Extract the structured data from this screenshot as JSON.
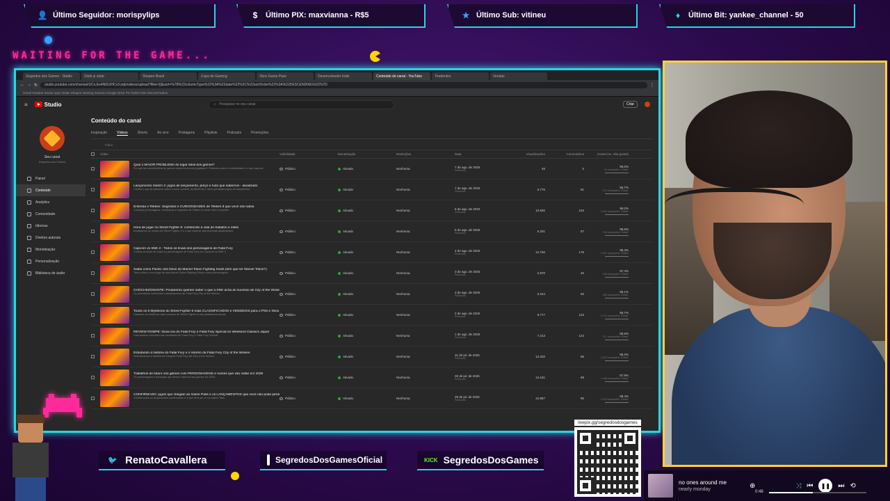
{
  "overlay": {
    "banners": [
      {
        "label": "Último Seguidor: morispylips",
        "icon": "user-icon"
      },
      {
        "label": "Último PIX: maxvianna - R$5",
        "icon": "dollar-icon"
      },
      {
        "label": "Último Sub: vitineu",
        "icon": "star-icon"
      },
      {
        "label": "Último Bit: yankee_channel - 50",
        "icon": "diamond-icon"
      }
    ],
    "waiting_text": "WAITING FOR THE GAME...",
    "socials": [
      {
        "handle": "RenatoCavallera",
        "icon": "twitter-icon"
      },
      {
        "handle": "SegredosDosGamesOficial",
        "icon": "instagram-icon"
      },
      {
        "handle": "SegredosDosGames",
        "icon": "kick-icon",
        "badge": "KICK"
      }
    ],
    "qr_label": "livepix.gg/segredosdosgames",
    "player": {
      "track": "no ones around me",
      "artist": "nearly monday",
      "time": "0:48",
      "progress": 0.45
    }
  },
  "browser": {
    "tabs": [
      "Segredos dos Games - Stúdio",
      "Zdob și zdub",
      "Shopee Brasil",
      "Copa do Gaming",
      "Xbox Game Pass",
      "Desenvolvedor Indie",
      "Conteúdo do canal - YouTube",
      "Tiradentes",
      "Vendas"
    ],
    "active_tab": 6,
    "url": "studio.youtube.com/channel/UCxJxs4N56JHCv3-jrqk/videos/upload?filter=[]&sort=%7B%22columnType%22%3A%22date%22%2C%22sortOrder%22%3A%22DESCENDING%22%7D",
    "bookmarks": "Gmail   Youtube Studio   Apps   Notas   Shopee   Gaming   Amazon   Google Drive   Pix   Twitch   Kick   Discord   Notion"
  },
  "studio": {
    "logo_text": "Studio",
    "search_placeholder": "Pesquisar no seu canal",
    "create_label": "Criar",
    "channel_name": "Seu canal",
    "channel_sub": "Segredos dos Games",
    "sidebar": [
      "Painel",
      "Conteúdo",
      "Analytics",
      "Comunidade",
      "Idiomas",
      "Direitos autorais",
      "Monetização",
      "Personalização",
      "Biblioteca de áudio"
    ],
    "active_sidebar": 1,
    "page_title": "Conteúdo do canal",
    "tabs": [
      "Inspiração",
      "Vídeos",
      "Shorts",
      "Ao vivo",
      "Postagens",
      "Playlists",
      "Podcasts",
      "Promoções"
    ],
    "active_tab": 1,
    "filter_label": "Filtrar",
    "columns": [
      "Vídeo",
      "Visibilidade",
      "Monetização",
      "Restrições",
      "Data",
      "Visualizações",
      "Comentários",
      "Gostei (vs. não gostei)"
    ],
    "rows": [
      {
        "title": "Qual o MAIOR PROBLEMA do lugar ideal dos games?",
        "desc": "Por que tal característica de games ainda incomoda jogadores? Falamos sobre a comunidade e o que esperar.",
        "visibility": "Público",
        "monetization": "Ativado",
        "restrictions": "Nenhuma",
        "date": "7 de ago. de 2025",
        "status": "Publicado",
        "views": "46",
        "comments": "5",
        "like": "98,0%",
        "like_sub": "10 marcações 'Gostei'"
      },
      {
        "title": "Lançamento Switch 2: jogos de lançamento, preço e tudo que sabemos - atualizado",
        "desc": "Confira o que já sabemos sobre o novo console da Nintendo e seus principais jogos de lançamento.",
        "visibility": "Público",
        "monetization": "Ativado",
        "restrictions": "Nenhuma",
        "date": "7 de ago. de 2025",
        "status": "Publicado",
        "views": "5.776",
        "comments": "91",
        "like": "96,7%",
        "like_sub": "373 marcações 'Gostei'"
      },
      {
        "title": "Entenda o Tekken: Segredos e CURIOSIDADES de Tekken 8 que você não sabia",
        "desc": "Conheça personagens, mecânicas e segredos de Tekken 8 neste vídeo completo.",
        "visibility": "Público",
        "monetization": "Ativado",
        "restrictions": "Nenhuma",
        "date": "6 de ago. de 2025",
        "status": "Publicado",
        "views": "10.830",
        "comments": "153",
        "like": "98,2%",
        "like_sub": "1.023 marcações 'Gostei'"
      },
      {
        "title": "Hora de jogar no Street Fighter 6: conferindo a vida de trabalho e estilo",
        "desc": "Analisamos os modos de Street Fighter 6 e o que esperar das próximas atualizações.",
        "visibility": "Público",
        "monetization": "Ativado",
        "restrictions": "Nenhuma",
        "date": "5 de ago. de 2025",
        "status": "Publicado",
        "views": "6.201",
        "comments": "57",
        "like": "98,6%",
        "like_sub": "745 marcações 'Gostei'"
      },
      {
        "title": "Capcom vs SNK 2 - Todos os finais dos personagens de Fatal Fury",
        "desc": "Confira os finais de todos os personagens de Fatal Fury em Capcom vs SNK 2.",
        "visibility": "Público",
        "monetization": "Ativado",
        "restrictions": "Nenhuma",
        "date": "4 de ago. de 2025",
        "status": "Publicado",
        "views": "12.750",
        "comments": "175",
        "like": "98,3%",
        "like_sub": "1.257 marcações 'Gostei'"
      },
      {
        "title": "Saiba como Pacific dos Deus do Marvel Tokon Fighting Souls (tem que ter Marvel Tokon?)",
        "desc": "Tudo sobre o novo jogo de luta Marvel Tokon Fighting Souls e seus personagens.",
        "visibility": "Público",
        "monetization": "Ativado",
        "restrictions": "Nenhuma",
        "date": "3 de ago. de 2025",
        "status": "Publicado",
        "views": "2.870",
        "comments": "40",
        "like": "97,4%",
        "like_sub": "298 marcações 'Gostei'"
      },
      {
        "title": "CHOCHEZONANTE: Produtores querem saber o que a SNK acha do sucesso de City of the Wolves",
        "desc": "Os produtores comentam o desempenho de Fatal Fury City of the Wolves.",
        "visibility": "Público",
        "monetization": "Ativado",
        "restrictions": "Nenhuma",
        "date": "3 de ago. de 2025",
        "status": "Publicado",
        "views": "5.244",
        "comments": "52",
        "like": "98,1%",
        "like_sub": "482 marcações 'Gostei'"
      },
      {
        "title": "Todos os 6 Mystérios do Street Fighter 6 mais CLASSIFICADOS e VENDIDOS para o PS5 e Xbox",
        "desc": "Listamos os mistérios mais curiosos de Street Fighter 6 nas plataformas atuais.",
        "visibility": "Público",
        "monetization": "Ativado",
        "restrictions": "Nenhuma",
        "date": "2 de ago. de 2025",
        "status": "Publicado",
        "views": "9.777",
        "comments": "123",
        "like": "98,7%",
        "like_sub": "1.213 marcações 'Gostei'"
      },
      {
        "title": "REVIEW ROMPE: Nova era do Fatal Fury e Fatal Fury Special no Weekend Classics Japan",
        "desc": "Uma análise completa das novidades de Fatal Fury e Fatal Fury Special.",
        "visibility": "Público",
        "monetization": "Ativado",
        "restrictions": "Nenhuma",
        "date": "1 de ago. de 2025",
        "status": "Publicado",
        "views": "7.213",
        "comments": "122",
        "like": "98,5%",
        "like_sub": "717 marcações 'Gostei'"
      },
      {
        "title": "Estudando a história do Fatal Fury e o retorno da Fatal Fury City of the Wolves",
        "desc": "Relembramos a história da franquia Fatal Fury até City of the Wolves.",
        "visibility": "Público",
        "monetization": "Ativado",
        "restrictions": "Nenhuma",
        "date": "31 de jul. de 2025",
        "status": "Publicado",
        "views": "14.332",
        "comments": "56",
        "like": "98,2%",
        "like_sub": "1.312 marcações 'Gostei'"
      },
      {
        "title": "Trabalhos do futuro nos games com PERSONAGENS e nomes que vão voltar em 2026",
        "desc": "Os personagens e franquias que devem retornar aos games em 2026.",
        "visibility": "Público",
        "monetization": "Ativado",
        "restrictions": "Nenhuma",
        "date": "30 de jul. de 2025",
        "status": "Publicado",
        "views": "12.181",
        "comments": "88",
        "like": "97,9%",
        "like_sub": "1.188 marcações 'Gostei'"
      },
      {
        "title": "CONFIRMADO: jogos que chegam ao Game Pass e os LANÇAMENTOS que você não pode perder",
        "desc": "Confira todos os lançamentos confirmados e o que vem por aí no Game Pass.",
        "visibility": "Público",
        "monetization": "Ativado",
        "restrictions": "Nenhuma",
        "date": "29 de jul. de 2025",
        "status": "Publicado",
        "views": "22.887",
        "comments": "90",
        "like": "98,4%",
        "like_sub": "2.215 marcações 'Gostei'"
      }
    ]
  },
  "colors": {
    "accent": "#2ad6e0",
    "cam_border": "#ffd23a",
    "pink": "#ff2a9a"
  }
}
